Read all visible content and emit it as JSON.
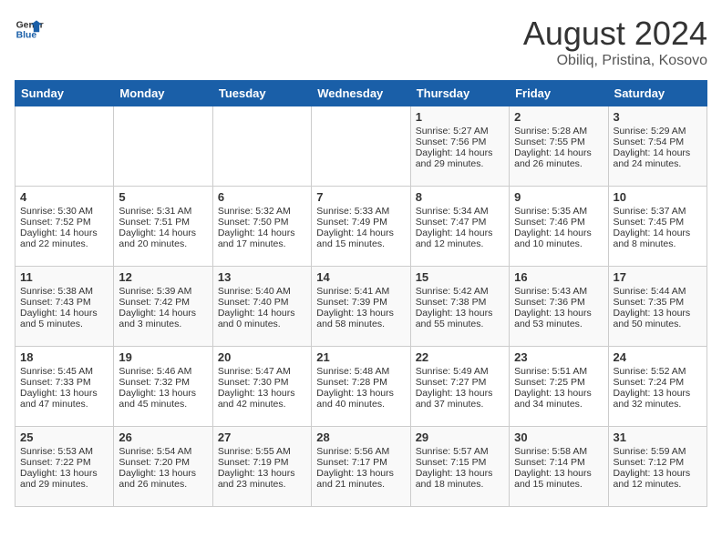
{
  "header": {
    "logo_line1": "General",
    "logo_line2": "Blue",
    "month": "August 2024",
    "location": "Obiliq, Pristina, Kosovo"
  },
  "days_of_week": [
    "Sunday",
    "Monday",
    "Tuesday",
    "Wednesday",
    "Thursday",
    "Friday",
    "Saturday"
  ],
  "weeks": [
    [
      {
        "day": "",
        "info": ""
      },
      {
        "day": "",
        "info": ""
      },
      {
        "day": "",
        "info": ""
      },
      {
        "day": "",
        "info": ""
      },
      {
        "day": "1",
        "info": "Sunrise: 5:27 AM\nSunset: 7:56 PM\nDaylight: 14 hours and 29 minutes."
      },
      {
        "day": "2",
        "info": "Sunrise: 5:28 AM\nSunset: 7:55 PM\nDaylight: 14 hours and 26 minutes."
      },
      {
        "day": "3",
        "info": "Sunrise: 5:29 AM\nSunset: 7:54 PM\nDaylight: 14 hours and 24 minutes."
      }
    ],
    [
      {
        "day": "4",
        "info": "Sunrise: 5:30 AM\nSunset: 7:52 PM\nDaylight: 14 hours and 22 minutes."
      },
      {
        "day": "5",
        "info": "Sunrise: 5:31 AM\nSunset: 7:51 PM\nDaylight: 14 hours and 20 minutes."
      },
      {
        "day": "6",
        "info": "Sunrise: 5:32 AM\nSunset: 7:50 PM\nDaylight: 14 hours and 17 minutes."
      },
      {
        "day": "7",
        "info": "Sunrise: 5:33 AM\nSunset: 7:49 PM\nDaylight: 14 hours and 15 minutes."
      },
      {
        "day": "8",
        "info": "Sunrise: 5:34 AM\nSunset: 7:47 PM\nDaylight: 14 hours and 12 minutes."
      },
      {
        "day": "9",
        "info": "Sunrise: 5:35 AM\nSunset: 7:46 PM\nDaylight: 14 hours and 10 minutes."
      },
      {
        "day": "10",
        "info": "Sunrise: 5:37 AM\nSunset: 7:45 PM\nDaylight: 14 hours and 8 minutes."
      }
    ],
    [
      {
        "day": "11",
        "info": "Sunrise: 5:38 AM\nSunset: 7:43 PM\nDaylight: 14 hours and 5 minutes."
      },
      {
        "day": "12",
        "info": "Sunrise: 5:39 AM\nSunset: 7:42 PM\nDaylight: 14 hours and 3 minutes."
      },
      {
        "day": "13",
        "info": "Sunrise: 5:40 AM\nSunset: 7:40 PM\nDaylight: 14 hours and 0 minutes."
      },
      {
        "day": "14",
        "info": "Sunrise: 5:41 AM\nSunset: 7:39 PM\nDaylight: 13 hours and 58 minutes."
      },
      {
        "day": "15",
        "info": "Sunrise: 5:42 AM\nSunset: 7:38 PM\nDaylight: 13 hours and 55 minutes."
      },
      {
        "day": "16",
        "info": "Sunrise: 5:43 AM\nSunset: 7:36 PM\nDaylight: 13 hours and 53 minutes."
      },
      {
        "day": "17",
        "info": "Sunrise: 5:44 AM\nSunset: 7:35 PM\nDaylight: 13 hours and 50 minutes."
      }
    ],
    [
      {
        "day": "18",
        "info": "Sunrise: 5:45 AM\nSunset: 7:33 PM\nDaylight: 13 hours and 47 minutes."
      },
      {
        "day": "19",
        "info": "Sunrise: 5:46 AM\nSunset: 7:32 PM\nDaylight: 13 hours and 45 minutes."
      },
      {
        "day": "20",
        "info": "Sunrise: 5:47 AM\nSunset: 7:30 PM\nDaylight: 13 hours and 42 minutes."
      },
      {
        "day": "21",
        "info": "Sunrise: 5:48 AM\nSunset: 7:28 PM\nDaylight: 13 hours and 40 minutes."
      },
      {
        "day": "22",
        "info": "Sunrise: 5:49 AM\nSunset: 7:27 PM\nDaylight: 13 hours and 37 minutes."
      },
      {
        "day": "23",
        "info": "Sunrise: 5:51 AM\nSunset: 7:25 PM\nDaylight: 13 hours and 34 minutes."
      },
      {
        "day": "24",
        "info": "Sunrise: 5:52 AM\nSunset: 7:24 PM\nDaylight: 13 hours and 32 minutes."
      }
    ],
    [
      {
        "day": "25",
        "info": "Sunrise: 5:53 AM\nSunset: 7:22 PM\nDaylight: 13 hours and 29 minutes."
      },
      {
        "day": "26",
        "info": "Sunrise: 5:54 AM\nSunset: 7:20 PM\nDaylight: 13 hours and 26 minutes."
      },
      {
        "day": "27",
        "info": "Sunrise: 5:55 AM\nSunset: 7:19 PM\nDaylight: 13 hours and 23 minutes."
      },
      {
        "day": "28",
        "info": "Sunrise: 5:56 AM\nSunset: 7:17 PM\nDaylight: 13 hours and 21 minutes."
      },
      {
        "day": "29",
        "info": "Sunrise: 5:57 AM\nSunset: 7:15 PM\nDaylight: 13 hours and 18 minutes."
      },
      {
        "day": "30",
        "info": "Sunrise: 5:58 AM\nSunset: 7:14 PM\nDaylight: 13 hours and 15 minutes."
      },
      {
        "day": "31",
        "info": "Sunrise: 5:59 AM\nSunset: 7:12 PM\nDaylight: 13 hours and 12 minutes."
      }
    ]
  ]
}
